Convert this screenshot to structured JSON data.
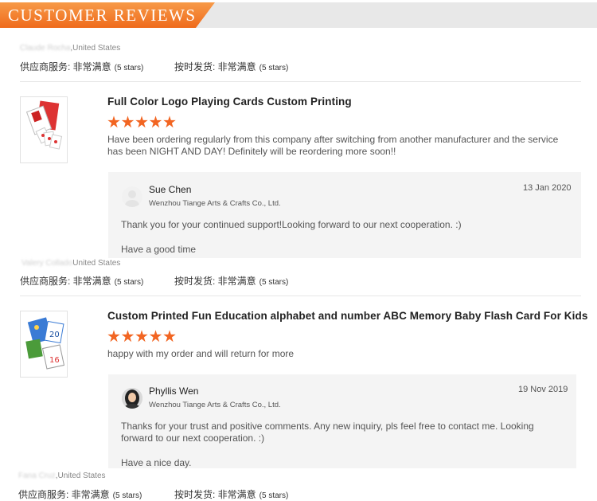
{
  "header": {
    "title": "CUSTOMER REVIEWS"
  },
  "reviews": [
    {
      "reviewer_name": "Claude Rocha",
      "country": ",United States",
      "service_label": "供应商服务: 非常满意",
      "service_stars": "(5 stars)",
      "delivery_label": "按时发货: 非常满意",
      "delivery_stars": "(5 stars)",
      "product_title": "Full Color Logo Playing Cards Custom Printing",
      "rating": 5,
      "text": "Have been ordering regularly from this company after switching from another manufacturer and the service has been NIGHT AND DAY! Definitely will be reordering more soon!!",
      "reply": {
        "name": "Sue Chen",
        "company": "Wenzhou Tiange Arts & Crafts Co., Ltd.",
        "date": "13 Jan 2020",
        "line1": "Thank you for your continued support!Looking forward to our next cooperation. :)",
        "line2": "Have a good time"
      }
    },
    {
      "reviewer_name": "Valery Collado",
      "country": "United States",
      "service_label": "供应商服务: 非常满意",
      "service_stars": "(5 stars)",
      "delivery_label": "按时发货: 非常满意",
      "delivery_stars": "(5 stars)",
      "product_title": "Custom Printed Fun Education alphabet and number ABC Memory Baby Flash Card For Kids",
      "rating": 5,
      "text": "happy with my order and will return for more",
      "reply": {
        "name": "Phyllis Wen",
        "company": "Wenzhou Tiange Arts & Crafts Co., Ltd.",
        "date": "19 Nov 2019",
        "line1": "Thanks for your trust and positive comments. Any new inquiry, pls feel free to contact me. Looking forward to our next cooperation. :)",
        "line2": "Have a nice day."
      }
    },
    {
      "reviewer_name": "Fana Cruz",
      "country": ",United States",
      "service_label": "供应商服务: 非常满意",
      "service_stars": "(5 stars)",
      "delivery_label": "按时发货: 非常满意",
      "delivery_stars": "(5 stars)"
    }
  ],
  "icons": {
    "rating_star": "star-icon"
  },
  "colors": {
    "accent": "#f26522",
    "reply_bg": "#f4f4f4"
  }
}
